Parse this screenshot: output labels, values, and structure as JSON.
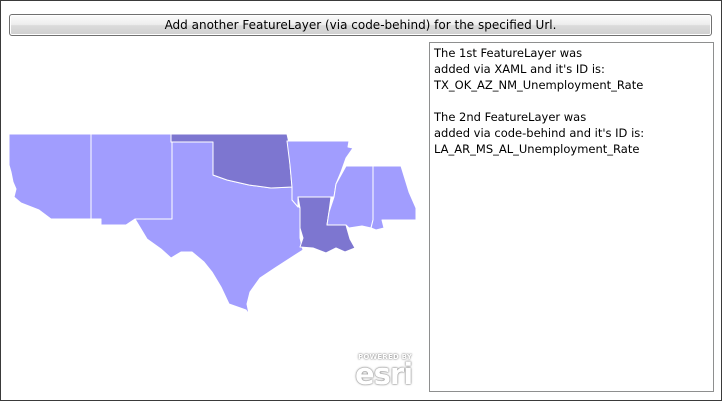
{
  "toolbar": {
    "add_layer_label": "Add another FeatureLayer (via code-behind) for the specified Url."
  },
  "info": {
    "first_layer": {
      "line1": "The 1st FeatureLayer was",
      "line2": "added via XAML and it's ID is:",
      "id": "TX_OK_AZ_NM_Unemployment_Rate"
    },
    "second_layer": {
      "line1": "The 2nd FeatureLayer was",
      "line2": "added via code-behind and it's ID is:",
      "id": "LA_AR_MS_AL_Unemployment_Rate"
    }
  },
  "logo": {
    "powered_by": "POWERED BY",
    "brand": "esri"
  },
  "map": {
    "colors": {
      "light_fill": "#a19dfe",
      "dark_fill": "#7d76d0",
      "stroke": "#ffffff"
    },
    "states": [
      {
        "name": "Arizona",
        "shade": "light"
      },
      {
        "name": "New Mexico",
        "shade": "light"
      },
      {
        "name": "Texas",
        "shade": "light"
      },
      {
        "name": "Oklahoma",
        "shade": "dark"
      },
      {
        "name": "Arkansas",
        "shade": "light"
      },
      {
        "name": "Louisiana",
        "shade": "dark"
      },
      {
        "name": "Mississippi",
        "shade": "light"
      },
      {
        "name": "Alabama",
        "shade": "light"
      }
    ]
  }
}
